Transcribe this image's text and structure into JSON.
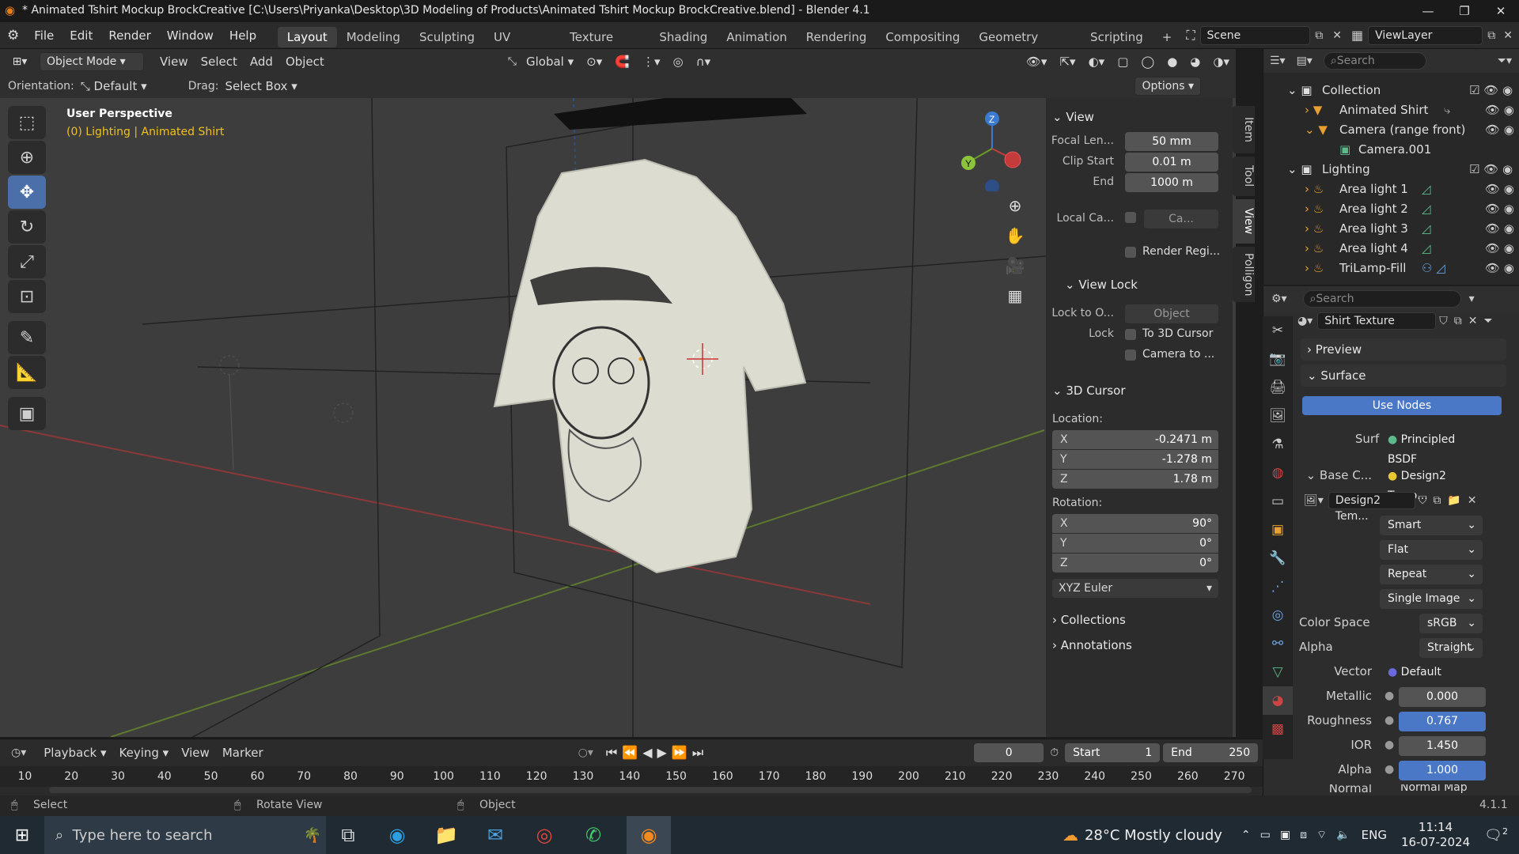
{
  "titlebar": {
    "title": "* Animated Tshirt Mockup BrockCreative [C:\\Users\\Priyanka\\Desktop\\3D Modeling of Products\\Animated Tshirt Mockup BrockCreative.blend] - Blender 4.1"
  },
  "menu": [
    "File",
    "Edit",
    "Render",
    "Window",
    "Help"
  ],
  "workspaces": [
    "Layout",
    "Modeling",
    "Sculpting",
    "UV Editing",
    "Texture Paint",
    "Shading",
    "Animation",
    "Rendering",
    "Compositing",
    "Geometry Nodes",
    "Scripting"
  ],
  "scene": {
    "label": "Scene",
    "viewlayer": "ViewLayer"
  },
  "viewport_header": {
    "mode": "Object Mode",
    "menus": [
      "View",
      "Select",
      "Add",
      "Object"
    ],
    "transform": "Global",
    "orientation_label": "Orientation:",
    "orientation": "Default",
    "drag_label": "Drag:",
    "drag": "Select Box",
    "options": "Options"
  },
  "viewport_overlay": {
    "perspective": "User Perspective",
    "info": "(0) Lighting | Animated Shirt"
  },
  "npanel": {
    "tabs": [
      "Item",
      "Tool",
      "View",
      "Polligon"
    ],
    "view_title": "View",
    "focal_label": "Focal Len...",
    "focal": "50 mm",
    "clip_start_label": "Clip Start",
    "clip_start": "0.01 m",
    "end_label": "End",
    "end": "1000 m",
    "local_cam_label": "Local Ca...",
    "local_cam": "Ca...",
    "render_region": "Render Regi...",
    "view_lock_title": "View Lock",
    "lock_to_label": "Lock to O...",
    "lock_to": "Object",
    "lock_label": "Lock",
    "to_cursor": "To 3D Cursor",
    "camera_to": "Camera to ...",
    "cursor_title": "3D Cursor",
    "location_label": "Location:",
    "loc": [
      {
        "axis": "X",
        "value": "-0.2471 m"
      },
      {
        "axis": "Y",
        "value": "-1.278 m"
      },
      {
        "axis": "Z",
        "value": "1.78 m"
      }
    ],
    "rotation_label": "Rotation:",
    "rot": [
      {
        "axis": "X",
        "value": "90°"
      },
      {
        "axis": "Y",
        "value": "0°"
      },
      {
        "axis": "Z",
        "value": "0°"
      }
    ],
    "euler": "XYZ Euler",
    "collections": "Collections",
    "annotations": "Annotations"
  },
  "outliner": {
    "search_placeholder": "Search",
    "rows": [
      {
        "label": "Collection"
      },
      {
        "label": "Animated Shirt"
      },
      {
        "label": "Camera (range front)"
      },
      {
        "label": "Camera.001"
      },
      {
        "label": "Lighting"
      },
      {
        "label": "Area light 1"
      },
      {
        "label": "Area light 2"
      },
      {
        "label": "Area light 3"
      },
      {
        "label": "Area light 4"
      },
      {
        "label": "TriLamp-Fill"
      }
    ]
  },
  "properties": {
    "search_placeholder": "Search",
    "material": "Shirt Texture",
    "preview": "Preview",
    "surface_section": "Surface",
    "use_nodes": "Use Nodes",
    "surface_label": "Surface",
    "surface": "Principled BSDF",
    "base_color_label": "Base C...",
    "base_color": "Design2 Temp...",
    "image_name": "Design2 Tem...",
    "interp": "Smart",
    "projection": "Flat",
    "extension": "Repeat",
    "source": "Single Image",
    "color_space_label": "Color Space",
    "color_space": "sRGB",
    "alpha_mode_label": "Alpha",
    "alpha_mode": "Straight",
    "vector_label": "Vector",
    "vector": "Default",
    "metallic_label": "Metallic",
    "metallic": "0.000",
    "roughness_label": "Roughness",
    "roughness": "0.767",
    "ior_label": "IOR",
    "ior": "1.450",
    "alpha_label": "Alpha",
    "alpha": "1.000",
    "normal_label": "Normal",
    "normal": "Normal Map"
  },
  "timeline": {
    "menus": [
      "Playback",
      "Keying",
      "View",
      "Marker"
    ],
    "current_frame": "0",
    "start_label": "Start",
    "start": "1",
    "end_label": "End",
    "end": "250",
    "ruler": [
      "10",
      "20",
      "30",
      "40",
      "50",
      "60",
      "70",
      "80",
      "90",
      "100",
      "110",
      "120",
      "130",
      "140",
      "150",
      "160",
      "170",
      "180",
      "190",
      "200",
      "210",
      "220",
      "230",
      "240",
      "250",
      "260",
      "270"
    ]
  },
  "statusbar": {
    "select": "Select",
    "rotate": "Rotate View",
    "object": "Object",
    "version": "4.1.1"
  },
  "taskbar": {
    "search_placeholder": "Type here to search",
    "weather": "28°C  Mostly cloudy",
    "lang": "ENG",
    "time": "11:14",
    "date": "16-07-2024",
    "notif_count": "2"
  },
  "colors": {
    "accent": "#4a77c6",
    "active_tool": "#4b6fa8",
    "viewport_bg": "#3d3d3d",
    "shirt": "#dcdcd0",
    "overlay_yellow": "#f0c020"
  }
}
